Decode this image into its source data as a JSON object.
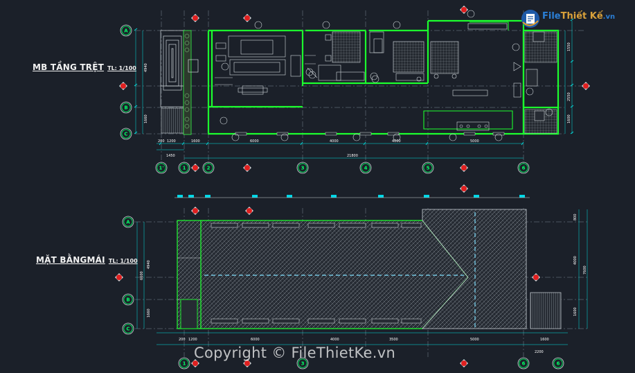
{
  "plans": [
    {
      "title": "MB TẦNG TRỆT",
      "scale": "TL: 1/100"
    },
    {
      "title": "MẶT BẰNGMÁI",
      "scale": "TL: 1/100"
    }
  ],
  "grid_rows": [
    "A",
    "B",
    "C"
  ],
  "grid_cols": [
    "1'",
    "1",
    "2",
    "3",
    "4",
    "5",
    "6"
  ],
  "dims_ground": {
    "bottom_row1": [
      "200",
      "1200",
      "1600",
      "6000",
      "4000",
      "4000",
      "5000"
    ],
    "bottom_row2": [
      "1450",
      "21800"
    ],
    "left": [
      "4940",
      "1660"
    ],
    "right": [
      "1550",
      "2550",
      "1600"
    ]
  },
  "dims_roof": {
    "bottom": [
      "200",
      "1200",
      "6000",
      "4000",
      "3500",
      "5000",
      "1600"
    ],
    "bottom2": "2200",
    "left": [
      "4940",
      "6600",
      "1660"
    ],
    "right": [
      "800",
      "4000",
      "1600",
      "7600"
    ]
  },
  "logo": {
    "name_a": "File",
    "name_b": "Thiết Kế",
    "suffix": ".vn"
  },
  "watermark": "Copyright © FileThietKe.vn",
  "colors": {
    "background": "#1b2029",
    "walls": "#00ff33",
    "lines": "#cfd6da",
    "grid_bubble": "#00ff66",
    "section_marker": "#e02020"
  }
}
